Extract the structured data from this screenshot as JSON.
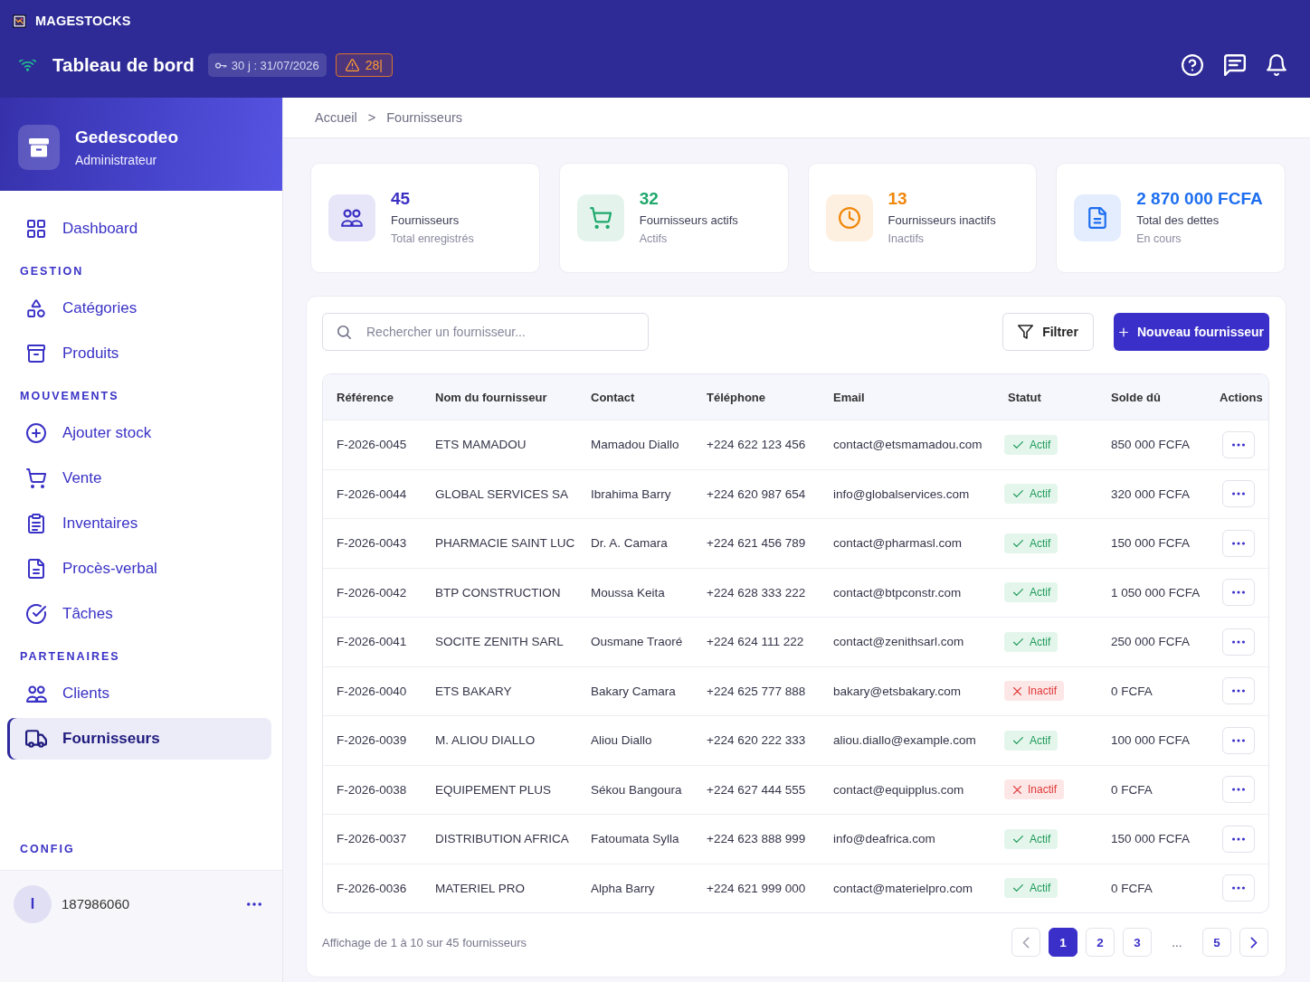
{
  "app_bar": {
    "app_name": "MAGESTOCKS",
    "title": "Tableau de bord",
    "license_badge": "30 j : 31/07/2026",
    "alert_badge": "28|"
  },
  "sidebar": {
    "profile": {
      "name": "Gedescodeo",
      "role": "Administrateur"
    },
    "sections": [
      {
        "items": [
          {
            "label": "Dashboard",
            "selected": false
          }
        ]
      },
      {
        "title": "GESTION",
        "items": [
          {
            "label": "Catégories",
            "selected": false
          },
          {
            "label": "Produits",
            "selected": false
          }
        ]
      },
      {
        "title": "MOUVEMENTS",
        "items": [
          {
            "label": "Ajouter stock",
            "selected": false
          },
          {
            "label": "Vente",
            "selected": false
          },
          {
            "label": "Inventaires",
            "selected": false
          },
          {
            "label": "Procès-verbal",
            "selected": false
          },
          {
            "label": "Tâches",
            "selected": false
          }
        ]
      },
      {
        "title": "PARTENAIRES",
        "items": [
          {
            "label": "Clients",
            "selected": false
          },
          {
            "label": "Fournisseurs",
            "selected": true
          }
        ]
      },
      {
        "title": "CONFIG"
      }
    ],
    "user": {
      "avatar_letter": "I",
      "id": "187986060"
    }
  },
  "breadcrumb": {
    "items": [
      "Accueil",
      "Fournisseurs"
    ],
    "separator": ">"
  },
  "stats": [
    {
      "value": "45",
      "label": "Fournisseurs",
      "sublabel": "Total enregistrés",
      "color": "#3b2fc4"
    },
    {
      "value": "32",
      "label": "Fournisseurs actifs",
      "sublabel": "Actifs",
      "color": "#1ea86b"
    },
    {
      "value": "13",
      "label": "Fournisseurs inactifs",
      "sublabel": "Inactifs",
      "color": "#f0870a"
    },
    {
      "value": "2 870 000 FCFA",
      "label": "Total des dettes",
      "sublabel": "En cours",
      "color": "#1d6ef0"
    }
  ],
  "toolbar": {
    "search": {
      "placeholder": "Rechercher un fournisseur..."
    },
    "filter_button": "Filtrer",
    "new_button": "Nouveau fournisseur"
  },
  "table": {
    "columns": [
      "Référence",
      "Nom du fournisseur",
      "Contact",
      "Téléphone",
      "Email",
      "Statut",
      "Solde dû",
      "Actions"
    ],
    "rows": [
      {
        "reference": "F-2026-0045",
        "name": "ETS MAMADOU",
        "contact": "Mamadou Diallo",
        "phone": "+224 622 123 456",
        "email": "contact@etsmamadou.com",
        "status": {
          "label": "Actif",
          "active": true
        },
        "balance": "850 000 FCFA"
      },
      {
        "reference": "F-2026-0044",
        "name": "GLOBAL SERVICES SA",
        "contact": "Ibrahima Barry",
        "phone": "+224 620 987 654",
        "email": "info@globalservices.com",
        "status": {
          "label": "Actif",
          "active": true
        },
        "balance": "320 000 FCFA"
      },
      {
        "reference": "F-2026-0043",
        "name": "PHARMACIE SAINT LUC",
        "contact": "Dr. A. Camara",
        "phone": "+224 621 456 789",
        "email": "contact@pharmasl.com",
        "status": {
          "label": "Actif",
          "active": true
        },
        "balance": "150 000 FCFA"
      },
      {
        "reference": "F-2026-0042",
        "name": "BTP CONSTRUCTION",
        "contact": "Moussa Keita",
        "phone": "+224 628 333 222",
        "email": "contact@btpconstr.com",
        "status": {
          "label": "Actif",
          "active": true
        },
        "balance": "1 050 000 FCFA"
      },
      {
        "reference": "F-2026-0041",
        "name": "SOCITE ZENITH SARL",
        "contact": "Ousmane Traoré",
        "phone": "+224 624 111 222",
        "email": "contact@zenithsarl.com",
        "status": {
          "label": "Actif",
          "active": true
        },
        "balance": "250 000 FCFA"
      },
      {
        "reference": "F-2026-0040",
        "name": "ETS BAKARY",
        "contact": "Bakary Camara",
        "phone": "+224 625 777 888",
        "email": "bakary@etsbakary.com",
        "status": {
          "label": "Inactif",
          "active": false
        },
        "balance": "0 FCFA"
      },
      {
        "reference": "F-2026-0039",
        "name": "M. ALIOU DIALLO",
        "contact": "Aliou Diallo",
        "phone": "+224 620 222 333",
        "email": "aliou.diallo@example.com",
        "status": {
          "label": "Actif",
          "active": true
        },
        "balance": "100 000 FCFA"
      },
      {
        "reference": "F-2026-0038",
        "name": "EQUIPEMENT PLUS",
        "contact": "Sékou Bangoura",
        "phone": "+224 627 444 555",
        "email": "contact@equipplus.com",
        "status": {
          "label": "Inactif",
          "active": false
        },
        "balance": "0 FCFA"
      },
      {
        "reference": "F-2026-0037",
        "name": "DISTRIBUTION AFRICA",
        "contact": "Fatoumata Sylla",
        "phone": "+224 623 888 999",
        "email": "info@deafrica.com",
        "status": {
          "label": "Actif",
          "active": true
        },
        "balance": "150 000 FCFA"
      },
      {
        "reference": "F-2026-0036",
        "name": "MATERIEL PRO",
        "contact": "Alpha Barry",
        "phone": "+224 621 999 000",
        "email": "contact@materielpro.com",
        "status": {
          "label": "Actif",
          "active": true
        },
        "balance": "0 FCFA"
      }
    ]
  },
  "pagination": {
    "summary": "Affichage de 1 à 10 sur 45 fournisseurs",
    "previous": {
      "disabled": true
    },
    "pages": [
      {
        "kind": "page",
        "label": "1",
        "selected": true
      },
      {
        "kind": "page",
        "label": "2",
        "selected": false
      },
      {
        "kind": "page",
        "label": "3",
        "selected": false
      },
      {
        "kind": "ellipsis",
        "label": "...",
        "selected": false
      },
      {
        "kind": "page",
        "label": "5",
        "selected": false
      }
    ],
    "next": {
      "disabled": false
    }
  }
}
